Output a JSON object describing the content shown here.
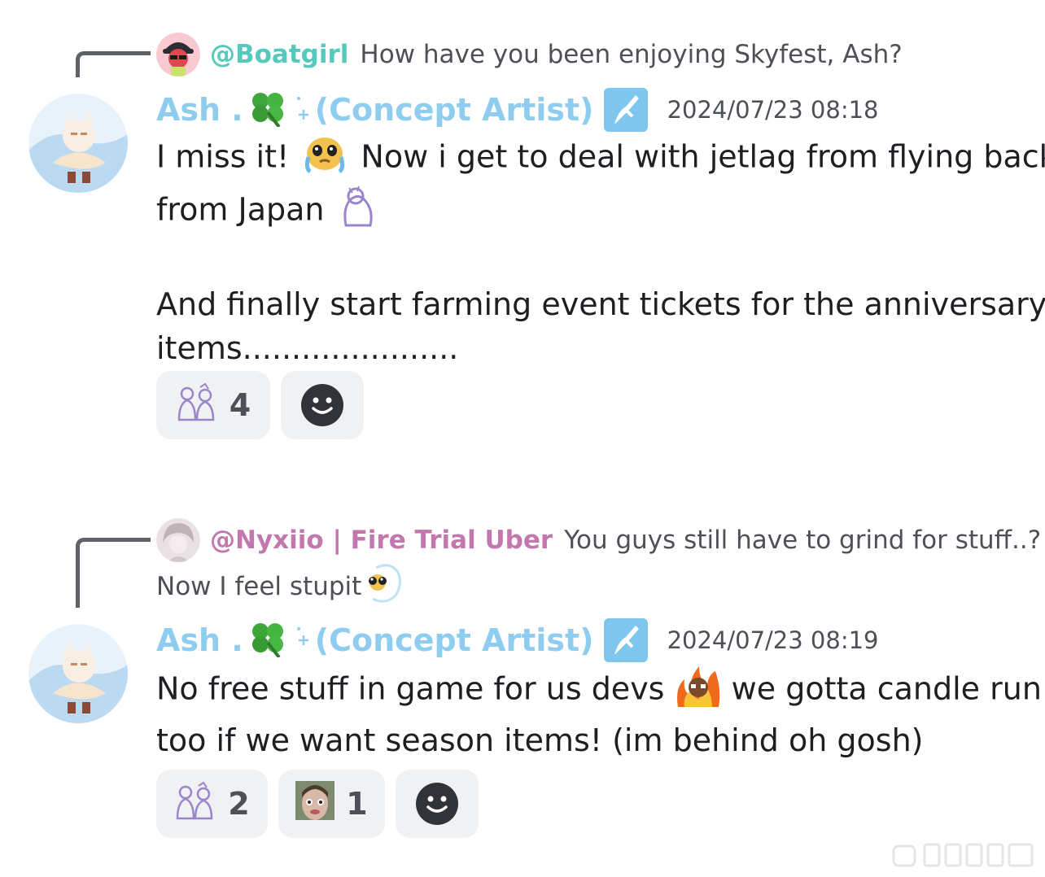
{
  "messages": [
    {
      "reply": {
        "name": "@Boatgirl",
        "name_color": "#56c9bd",
        "text": "How have you been enjoying Skyfest, Ash?",
        "avatar_icon": "boatgirl-avatar"
      },
      "author": {
        "name_start": "Ash .",
        "name_end": "(Concept Artist)",
        "clover_icon": "clover-icon",
        "sparkle_icon": "sparkle-icon",
        "badge_icon": "role-badge-icon",
        "color": "#8fcdf0"
      },
      "timestamp": "2024/07/23 08:18",
      "body_lines": [
        "I miss it!",
        "Now i get to deal with jetlag from flying back",
        "from Japan",
        "",
        "And finally start farming event tickets for the anniversary",
        "items......................"
      ],
      "reactions": [
        {
          "icon": "sky-children-icon",
          "count": "4"
        }
      ]
    },
    {
      "reply": {
        "name": "@Nyxiio | Fire Trial Uber",
        "name_color": "#c277ae",
        "text": "You guys still have to grind for stuff..?",
        "text_line2": "Now I feel stupit",
        "avatar_icon": "nyxiio-avatar"
      },
      "author": {
        "name_start": "Ash .",
        "name_end": "(Concept Artist)",
        "color": "#8fcdf0"
      },
      "timestamp": "2024/07/23 08:19",
      "body_lines": [
        "No free stuff in game for us devs",
        "we gotta candle run",
        "too if we want season items! (im behind oh gosh)"
      ],
      "reactions": [
        {
          "icon": "sky-children-icon",
          "count": "2"
        },
        {
          "icon": "face-mask-emoji",
          "count": "1"
        }
      ]
    }
  ]
}
